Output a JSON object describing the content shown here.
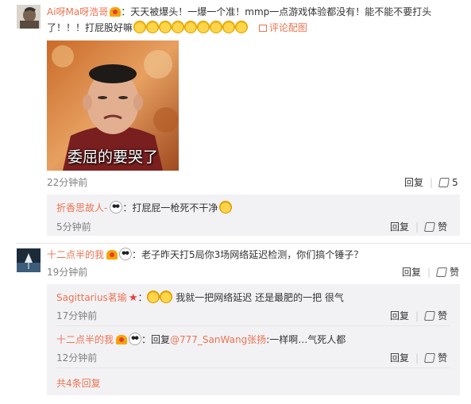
{
  "comment1": {
    "username": "Ai呀Ma呀浩哥",
    "text_line1": "：天天被爆头！一爆一个准！mmp一点游戏体验都没有！能不能不要打头",
    "text_line2": "了！！！打屁股好嘛",
    "view_image_label": "评论配图",
    "image_caption": "委屈的要哭了",
    "time": "22分钟前",
    "reply_label": "回复",
    "like_count": "5",
    "replies": [
      {
        "username": "折香思故人-",
        "text": "：打屁屁一枪死不干净",
        "time": "5分钟前",
        "reply_label": "回复",
        "like_label": "赞"
      }
    ]
  },
  "comment2": {
    "username": "十二点半的我",
    "text": "：老子昨天打5局你3场网络延迟检测，你们搞个锤子？",
    "time": "19分钟前",
    "reply_label": "回复",
    "like_label": "赞",
    "replies": [
      {
        "username": "Sagittarius茗瑜",
        "text_prefix": "：",
        "text": " 我就一把网络延迟 还是最肥的一把 很气",
        "time": "17分钟前",
        "reply_label": "回复",
        "like_label": "赞"
      },
      {
        "username": "十二点半的我",
        "text_prefix": "：回复",
        "mention": "@777_SanWang张扬",
        "text": ":一样啊…气死人都",
        "time": "12分钟前",
        "reply_label": "回复",
        "like_label": "赞"
      }
    ],
    "more_replies_label": "共4条回复"
  }
}
